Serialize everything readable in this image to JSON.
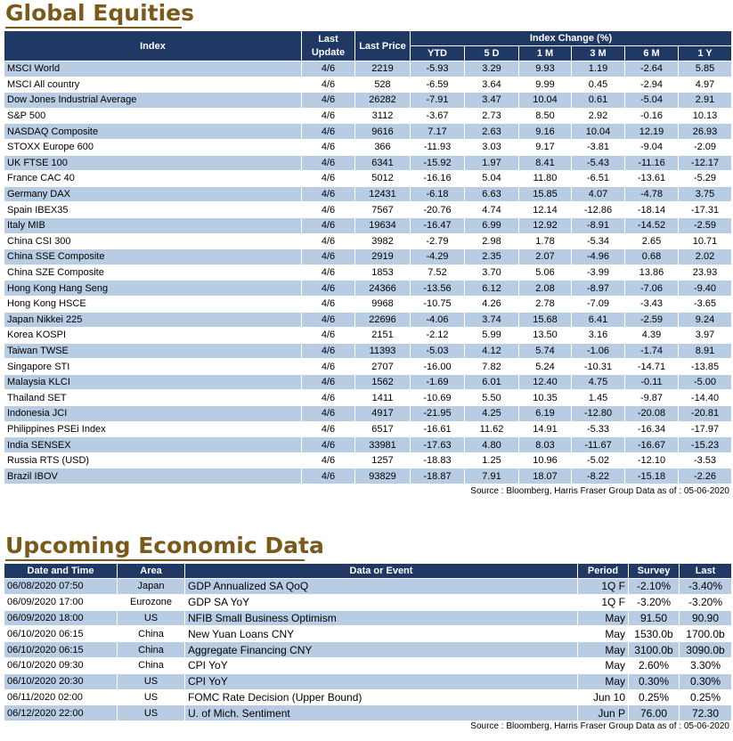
{
  "equities": {
    "title": "Global Equities",
    "headers": {
      "index": "Index",
      "last_update": "Last Update",
      "last_price": "Last Price",
      "index_change": "Index Change (%)",
      "periods": [
        "YTD",
        "5 D",
        "1 M",
        "3 M",
        "6 M",
        "1 Y"
      ]
    },
    "rows": [
      [
        "MSCI World",
        "4/6",
        "2219",
        "-5.93",
        "3.29",
        "9.93",
        "1.19",
        "-2.64",
        "5.85"
      ],
      [
        "MSCI All country",
        "4/6",
        "528",
        "-6.59",
        "3.64",
        "9.99",
        "0.45",
        "-2.94",
        "4.97"
      ],
      [
        "Dow Jones Industrial Average",
        "4/6",
        "26282",
        "-7.91",
        "3.47",
        "10.04",
        "0.61",
        "-5.04",
        "2.91"
      ],
      [
        "S&P 500",
        "4/6",
        "3112",
        "-3.67",
        "2.73",
        "8.50",
        "2.92",
        "-0.16",
        "10.13"
      ],
      [
        "NASDAQ Composite",
        "4/6",
        "9616",
        "7.17",
        "2.63",
        "9.16",
        "10.04",
        "12.19",
        "26.93"
      ],
      [
        "STOXX Europe 600",
        "4/6",
        "366",
        "-11.93",
        "3.03",
        "9.17",
        "-3.81",
        "-9.04",
        "-2.09"
      ],
      [
        "UK FTSE 100",
        "4/6",
        "6341",
        "-15.92",
        "1.97",
        "8.41",
        "-5.43",
        "-11.16",
        "-12.17"
      ],
      [
        "France CAC 40",
        "4/6",
        "5012",
        "-16.16",
        "5.04",
        "11.80",
        "-6.51",
        "-13.61",
        "-5.29"
      ],
      [
        "Germany DAX",
        "4/6",
        "12431",
        "-6.18",
        "6.63",
        "15.85",
        "4.07",
        "-4.78",
        "3.75"
      ],
      [
        "Spain IBEX35",
        "4/6",
        "7567",
        "-20.76",
        "4.74",
        "12.14",
        "-12.86",
        "-18.14",
        "-17.31"
      ],
      [
        "Italy MIB",
        "4/6",
        "19634",
        "-16.47",
        "6.99",
        "12.92",
        "-8.91",
        "-14.52",
        "-2.59"
      ],
      [
        "China CSI 300",
        "4/6",
        "3982",
        "-2.79",
        "2.98",
        "1.78",
        "-5.34",
        "2.65",
        "10.71"
      ],
      [
        "China SSE Composite",
        "4/6",
        "2919",
        "-4.29",
        "2.35",
        "2.07",
        "-4.96",
        "0.68",
        "2.02"
      ],
      [
        "China SZE Composite",
        "4/6",
        "1853",
        "7.52",
        "3.70",
        "5.06",
        "-3.99",
        "13.86",
        "23.93"
      ],
      [
        "Hong Kong Hang Seng",
        "4/6",
        "24366",
        "-13.56",
        "6.12",
        "2.08",
        "-8.97",
        "-7.06",
        "-9.40"
      ],
      [
        "Hong Kong HSCE",
        "4/6",
        "9968",
        "-10.75",
        "4.26",
        "2.78",
        "-7.09",
        "-3.43",
        "-3.65"
      ],
      [
        "Japan Nikkei 225",
        "4/6",
        "22696",
        "-4.06",
        "3.74",
        "15.68",
        "6.41",
        "-2.59",
        "9.24"
      ],
      [
        "Korea KOSPI",
        "4/6",
        "2151",
        "-2.12",
        "5.99",
        "13.50",
        "3.16",
        "4.39",
        "3.97"
      ],
      [
        "Taiwan TWSE",
        "4/6",
        "11393",
        "-5.03",
        "4.12",
        "5.74",
        "-1.06",
        "-1.74",
        "8.91"
      ],
      [
        "Singapore STI",
        "4/6",
        "2707",
        "-16.00",
        "7.82",
        "5.24",
        "-10.31",
        "-14.71",
        "-13.85"
      ],
      [
        "Malaysia KLCI",
        "4/6",
        "1562",
        "-1.69",
        "6.01",
        "12.40",
        "4.75",
        "-0.11",
        "-5.00"
      ],
      [
        "Thailand SET",
        "4/6",
        "1411",
        "-10.69",
        "5.50",
        "10.35",
        "1.45",
        "-9.87",
        "-14.40"
      ],
      [
        "Indonesia JCI",
        "4/6",
        "4917",
        "-21.95",
        "4.25",
        "6.19",
        "-12.80",
        "-20.08",
        "-20.81"
      ],
      [
        "Philippines PSEi Index",
        "4/6",
        "6517",
        "-16.61",
        "11.62",
        "14.91",
        "-5.33",
        "-16.34",
        "-17.97"
      ],
      [
        "India SENSEX",
        "4/6",
        "33981",
        "-17.63",
        "4.80",
        "8.03",
        "-11.67",
        "-16.67",
        "-15.23"
      ],
      [
        "Russia RTS (USD)",
        "4/6",
        "1257",
        "-18.83",
        "1.25",
        "10.96",
        "-5.02",
        "-12.10",
        "-3.53"
      ],
      [
        "Brazil IBOV",
        "4/6",
        "93829",
        "-18.87",
        "7.91",
        "18.07",
        "-8.22",
        "-15.18",
        "-2.26"
      ]
    ],
    "source": "Source : Bloomberg, Harris Fraser Group Data as of : 05-06-2020"
  },
  "economic": {
    "title": "Upcoming Economic Data",
    "headers": {
      "datetime": "Date and Time",
      "area": "Area",
      "event": "Data or Event",
      "period": "Period",
      "survey": "Survey",
      "last": "Last"
    },
    "rows": [
      [
        "06/08/2020 07:50",
        "Japan",
        "GDP Annualized SA QoQ",
        "1Q F",
        "-2.10%",
        "-3.40%"
      ],
      [
        "06/09/2020 17:00",
        "Eurozone",
        "GDP SA YoY",
        "1Q F",
        "-3.20%",
        "-3.20%"
      ],
      [
        "06/09/2020 18:00",
        "US",
        "NFIB Small Business Optimism",
        "May",
        "91.50",
        "90.90"
      ],
      [
        "06/10/2020 06:15",
        "China",
        "New Yuan Loans CNY",
        "May",
        "1530.0b",
        "1700.0b"
      ],
      [
        "06/10/2020 06:15",
        "China",
        "Aggregate Financing CNY",
        "May",
        "3100.0b",
        "3090.0b"
      ],
      [
        "06/10/2020 09:30",
        "China",
        "CPI YoY",
        "May",
        "2.60%",
        "3.30%"
      ],
      [
        "06/10/2020 20:30",
        "US",
        "CPI YoY",
        "May",
        "0.30%",
        "0.30%"
      ],
      [
        "06/11/2020 02:00",
        "US",
        "FOMC Rate Decision (Upper Bound)",
        "Jun 10",
        "0.25%",
        "0.25%"
      ],
      [
        "06/12/2020 22:00",
        "US",
        "U. of Mich. Sentiment",
        "Jun P",
        "76.00",
        "72.30"
      ]
    ],
    "source": "Source : Bloomberg, Harris Fraser Group Data as of : 05-06-2020"
  },
  "colors": {
    "header_bg": "#1f3864",
    "stripe": "#b8cce4",
    "title": "#7a5a1a"
  }
}
